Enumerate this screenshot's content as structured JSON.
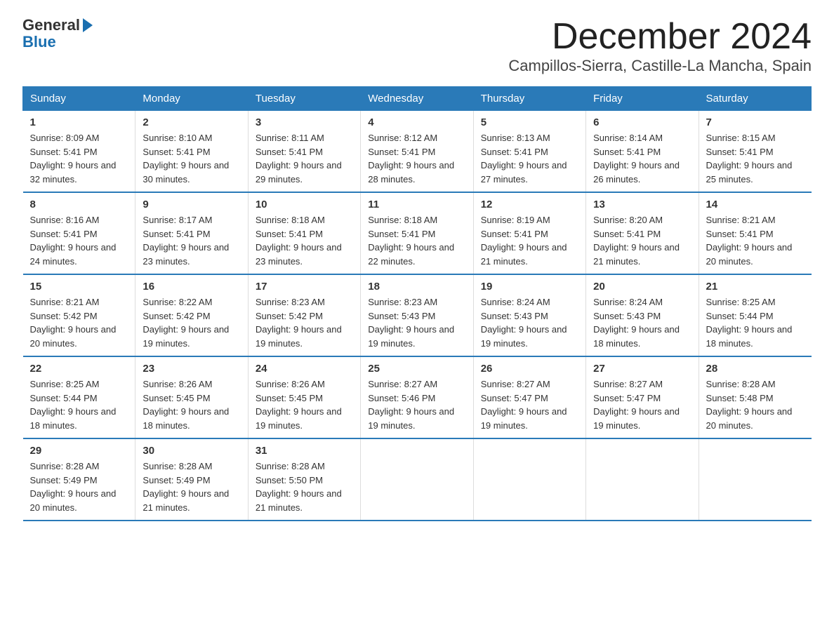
{
  "logo": {
    "general": "General",
    "arrow": "▶",
    "blue": "Blue"
  },
  "header": {
    "month": "December 2024",
    "location": "Campillos-Sierra, Castille-La Mancha, Spain"
  },
  "weekdays": [
    "Sunday",
    "Monday",
    "Tuesday",
    "Wednesday",
    "Thursday",
    "Friday",
    "Saturday"
  ],
  "weeks": [
    [
      {
        "day": "1",
        "sunrise": "8:09 AM",
        "sunset": "5:41 PM",
        "daylight": "9 hours and 32 minutes."
      },
      {
        "day": "2",
        "sunrise": "8:10 AM",
        "sunset": "5:41 PM",
        "daylight": "9 hours and 30 minutes."
      },
      {
        "day": "3",
        "sunrise": "8:11 AM",
        "sunset": "5:41 PM",
        "daylight": "9 hours and 29 minutes."
      },
      {
        "day": "4",
        "sunrise": "8:12 AM",
        "sunset": "5:41 PM",
        "daylight": "9 hours and 28 minutes."
      },
      {
        "day": "5",
        "sunrise": "8:13 AM",
        "sunset": "5:41 PM",
        "daylight": "9 hours and 27 minutes."
      },
      {
        "day": "6",
        "sunrise": "8:14 AM",
        "sunset": "5:41 PM",
        "daylight": "9 hours and 26 minutes."
      },
      {
        "day": "7",
        "sunrise": "8:15 AM",
        "sunset": "5:41 PM",
        "daylight": "9 hours and 25 minutes."
      }
    ],
    [
      {
        "day": "8",
        "sunrise": "8:16 AM",
        "sunset": "5:41 PM",
        "daylight": "9 hours and 24 minutes."
      },
      {
        "day": "9",
        "sunrise": "8:17 AM",
        "sunset": "5:41 PM",
        "daylight": "9 hours and 23 minutes."
      },
      {
        "day": "10",
        "sunrise": "8:18 AM",
        "sunset": "5:41 PM",
        "daylight": "9 hours and 23 minutes."
      },
      {
        "day": "11",
        "sunrise": "8:18 AM",
        "sunset": "5:41 PM",
        "daylight": "9 hours and 22 minutes."
      },
      {
        "day": "12",
        "sunrise": "8:19 AM",
        "sunset": "5:41 PM",
        "daylight": "9 hours and 21 minutes."
      },
      {
        "day": "13",
        "sunrise": "8:20 AM",
        "sunset": "5:41 PM",
        "daylight": "9 hours and 21 minutes."
      },
      {
        "day": "14",
        "sunrise": "8:21 AM",
        "sunset": "5:41 PM",
        "daylight": "9 hours and 20 minutes."
      }
    ],
    [
      {
        "day": "15",
        "sunrise": "8:21 AM",
        "sunset": "5:42 PM",
        "daylight": "9 hours and 20 minutes."
      },
      {
        "day": "16",
        "sunrise": "8:22 AM",
        "sunset": "5:42 PM",
        "daylight": "9 hours and 19 minutes."
      },
      {
        "day": "17",
        "sunrise": "8:23 AM",
        "sunset": "5:42 PM",
        "daylight": "9 hours and 19 minutes."
      },
      {
        "day": "18",
        "sunrise": "8:23 AM",
        "sunset": "5:43 PM",
        "daylight": "9 hours and 19 minutes."
      },
      {
        "day": "19",
        "sunrise": "8:24 AM",
        "sunset": "5:43 PM",
        "daylight": "9 hours and 19 minutes."
      },
      {
        "day": "20",
        "sunrise": "8:24 AM",
        "sunset": "5:43 PM",
        "daylight": "9 hours and 18 minutes."
      },
      {
        "day": "21",
        "sunrise": "8:25 AM",
        "sunset": "5:44 PM",
        "daylight": "9 hours and 18 minutes."
      }
    ],
    [
      {
        "day": "22",
        "sunrise": "8:25 AM",
        "sunset": "5:44 PM",
        "daylight": "9 hours and 18 minutes."
      },
      {
        "day": "23",
        "sunrise": "8:26 AM",
        "sunset": "5:45 PM",
        "daylight": "9 hours and 18 minutes."
      },
      {
        "day": "24",
        "sunrise": "8:26 AM",
        "sunset": "5:45 PM",
        "daylight": "9 hours and 19 minutes."
      },
      {
        "day": "25",
        "sunrise": "8:27 AM",
        "sunset": "5:46 PM",
        "daylight": "9 hours and 19 minutes."
      },
      {
        "day": "26",
        "sunrise": "8:27 AM",
        "sunset": "5:47 PM",
        "daylight": "9 hours and 19 minutes."
      },
      {
        "day": "27",
        "sunrise": "8:27 AM",
        "sunset": "5:47 PM",
        "daylight": "9 hours and 19 minutes."
      },
      {
        "day": "28",
        "sunrise": "8:28 AM",
        "sunset": "5:48 PM",
        "daylight": "9 hours and 20 minutes."
      }
    ],
    [
      {
        "day": "29",
        "sunrise": "8:28 AM",
        "sunset": "5:49 PM",
        "daylight": "9 hours and 20 minutes."
      },
      {
        "day": "30",
        "sunrise": "8:28 AM",
        "sunset": "5:49 PM",
        "daylight": "9 hours and 21 minutes."
      },
      {
        "day": "31",
        "sunrise": "8:28 AM",
        "sunset": "5:50 PM",
        "daylight": "9 hours and 21 minutes."
      },
      null,
      null,
      null,
      null
    ]
  ]
}
